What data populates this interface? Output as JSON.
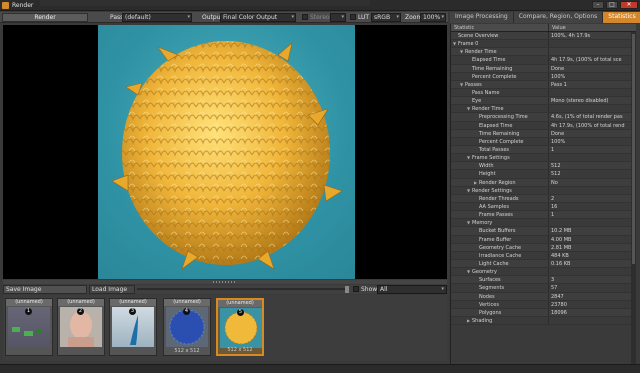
{
  "window": {
    "title": "Render"
  },
  "toolbar": {
    "render_label": "Render",
    "pass_label": "Pass",
    "pass_value": "(default)",
    "output_label": "Output",
    "output_value": "Final Color Output",
    "stereo_label": "Stereo",
    "lut_label": "LUT",
    "lut_value": "sRGB",
    "zoom_label": "Zoom",
    "zoom_value": "100%"
  },
  "tabs": [
    {
      "label": "Image Processing",
      "active": false
    },
    {
      "label": "Compare, Region, Options",
      "active": false
    },
    {
      "label": "Statistics",
      "active": true
    }
  ],
  "image_bar": {
    "save_label": "Save Image",
    "load_label": "Load Image",
    "show_label": "Show",
    "show_value": "All"
  },
  "thumbnails": [
    {
      "name": "(unnamed)",
      "badge": "1",
      "size": "",
      "selected": false
    },
    {
      "name": "(unnamed)",
      "badge": "2",
      "size": "",
      "selected": false
    },
    {
      "name": "(unnamed)",
      "badge": "3",
      "size": "",
      "selected": false
    },
    {
      "name": "(unnamed)",
      "badge": "4",
      "size": "512 x 512",
      "selected": false
    },
    {
      "name": "(unnamed)",
      "badge": "5",
      "size": "512 x 512",
      "selected": true
    }
  ],
  "stats": {
    "col_statistic": "Statistic",
    "col_value": "Value",
    "rows": [
      {
        "indent": 0,
        "arrow": "",
        "key": "Scene Overview",
        "value": "100%, 4h 17.9s"
      },
      {
        "indent": 0,
        "arrow": "▼",
        "key": "Frame 0",
        "value": ""
      },
      {
        "indent": 1,
        "arrow": "▼",
        "key": "Render Time",
        "value": ""
      },
      {
        "indent": 2,
        "arrow": "",
        "key": "Elapsed Time",
        "value": "4h 17.9s, (100% of total sce"
      },
      {
        "indent": 2,
        "arrow": "",
        "key": "Time Remaining",
        "value": "Done"
      },
      {
        "indent": 2,
        "arrow": "",
        "key": "Percent Complete",
        "value": "100%"
      },
      {
        "indent": 1,
        "arrow": "▼",
        "key": "Passes",
        "value": "Pass 1"
      },
      {
        "indent": 2,
        "arrow": "",
        "key": "Pass Name",
        "value": ""
      },
      {
        "indent": 2,
        "arrow": "",
        "key": "Eye",
        "value": "Mono (stereo disabled)"
      },
      {
        "indent": 2,
        "arrow": "▼",
        "key": "Render Time",
        "value": ""
      },
      {
        "indent": 3,
        "arrow": "",
        "key": "Preprocessing Time",
        "value": "4.6s, (1% of total render pas"
      },
      {
        "indent": 3,
        "arrow": "",
        "key": "Elapsed Time",
        "value": "4h 17.9s, (100% of total rend"
      },
      {
        "indent": 3,
        "arrow": "",
        "key": "Time Remaining",
        "value": "Done"
      },
      {
        "indent": 3,
        "arrow": "",
        "key": "Percent Complete",
        "value": "100%"
      },
      {
        "indent": 3,
        "arrow": "",
        "key": "Total Passes",
        "value": "1"
      },
      {
        "indent": 2,
        "arrow": "▼",
        "key": "Frame Settings",
        "value": ""
      },
      {
        "indent": 3,
        "arrow": "",
        "key": "Width",
        "value": "512"
      },
      {
        "indent": 3,
        "arrow": "",
        "key": "Height",
        "value": "512"
      },
      {
        "indent": 3,
        "arrow": "▶",
        "key": "Render Region",
        "value": "No"
      },
      {
        "indent": 2,
        "arrow": "▼",
        "key": "Render Settings",
        "value": ""
      },
      {
        "indent": 3,
        "arrow": "",
        "key": "Render Threads",
        "value": "2"
      },
      {
        "indent": 3,
        "arrow": "",
        "key": "AA Samples",
        "value": "16"
      },
      {
        "indent": 3,
        "arrow": "",
        "key": "Frame Passes",
        "value": "1"
      },
      {
        "indent": 2,
        "arrow": "▼",
        "key": "Memory",
        "value": ""
      },
      {
        "indent": 3,
        "arrow": "",
        "key": "Bucket Buffers",
        "value": "10.2 MB"
      },
      {
        "indent": 3,
        "arrow": "",
        "key": "Frame Buffer",
        "value": "4.00 MB"
      },
      {
        "indent": 3,
        "arrow": "",
        "key": "Geometry Cache",
        "value": "2.81 MB"
      },
      {
        "indent": 3,
        "arrow": "",
        "key": "Irradiance Cache",
        "value": "484 KB"
      },
      {
        "indent": 3,
        "arrow": "",
        "key": "Light Cache",
        "value": "0.16 KB"
      },
      {
        "indent": 2,
        "arrow": "▼",
        "key": "Geometry",
        "value": ""
      },
      {
        "indent": 3,
        "arrow": "",
        "key": "Surfaces",
        "value": "3"
      },
      {
        "indent": 3,
        "arrow": "",
        "key": "Segments",
        "value": "57"
      },
      {
        "indent": 3,
        "arrow": "",
        "key": "Nodes",
        "value": "2847"
      },
      {
        "indent": 3,
        "arrow": "",
        "key": "Vertices",
        "value": "23780"
      },
      {
        "indent": 3,
        "arrow": "",
        "key": "Polygons",
        "value": "18096"
      },
      {
        "indent": 2,
        "arrow": "▶",
        "key": "Shading",
        "value": ""
      }
    ]
  }
}
